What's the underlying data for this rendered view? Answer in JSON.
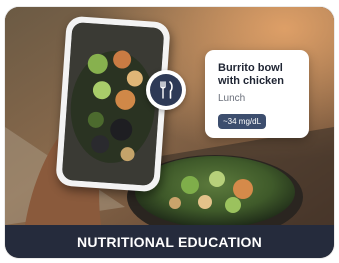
{
  "card": {
    "image_alt": "Hand holding a phone photographing a burrito bowl",
    "meal": {
      "title": "Burrito bowl with chicken",
      "type": "Lunch",
      "glucose_badge": "~34 mg/dL",
      "icon": "fork-knife-icon"
    },
    "banner": {
      "label": "NUTRITIONAL EDUCATION"
    }
  },
  "colors": {
    "banner_bg": "#252b3c",
    "badge_bg": "#2e3a56",
    "pill_bg": "#3d4e6e",
    "card_text": "#1f2533"
  }
}
